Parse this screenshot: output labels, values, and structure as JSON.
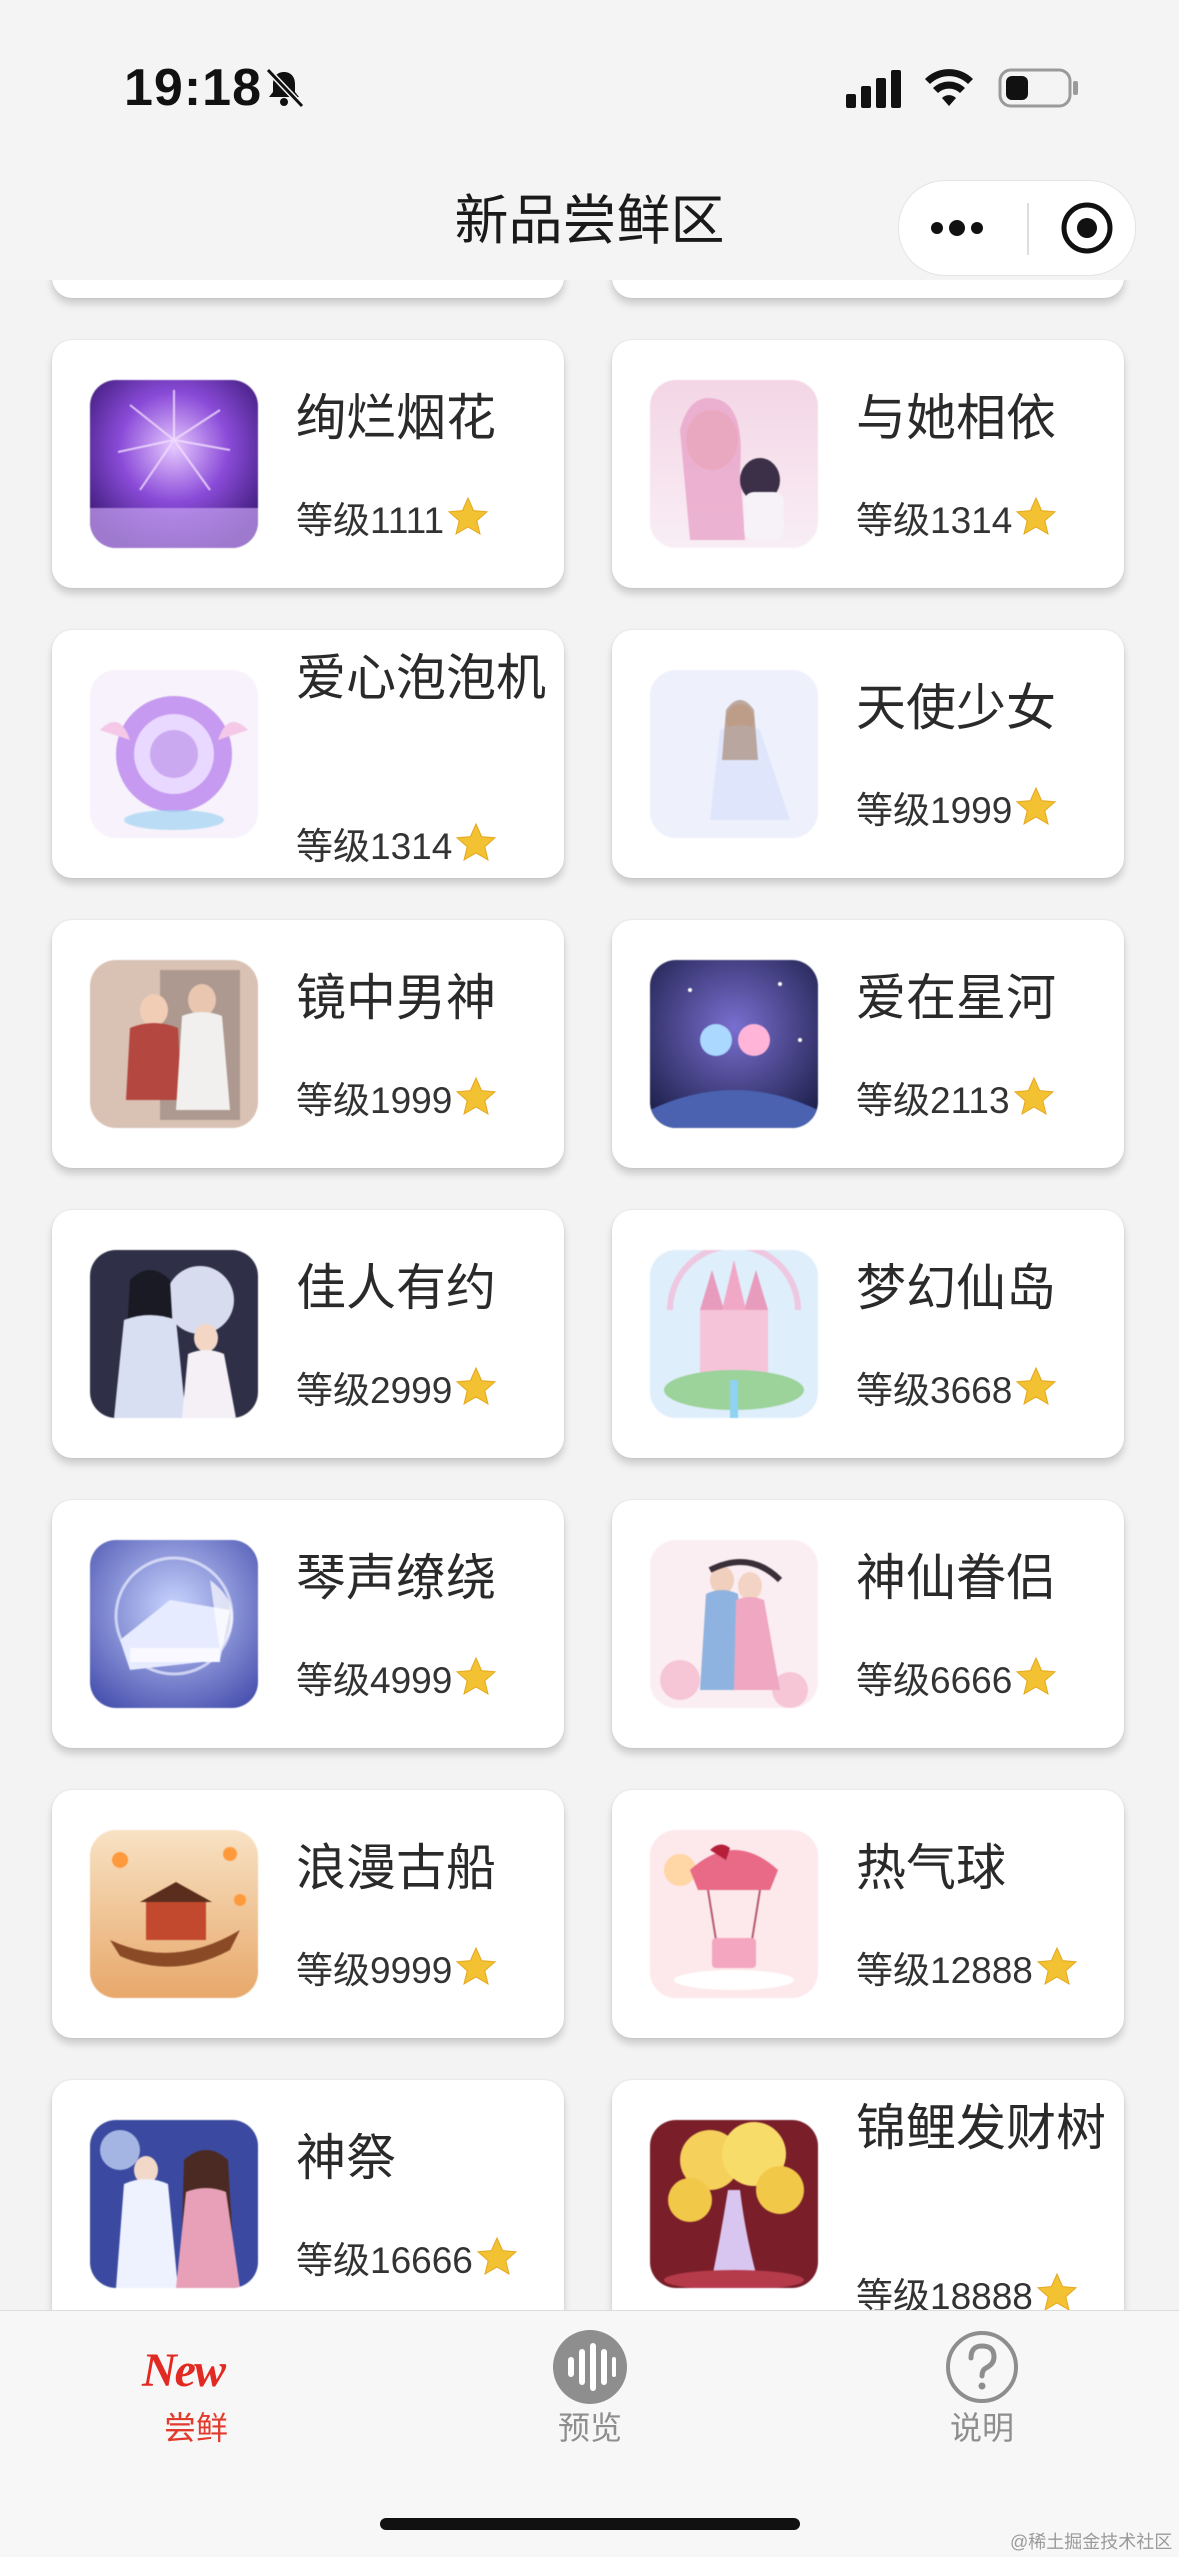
{
  "status_bar": {
    "time": "19:18"
  },
  "nav": {
    "title": "新品尝鲜区"
  },
  "items": [
    {
      "title": "绚烂烟花",
      "level": "等级1111",
      "thumb": "fireworks"
    },
    {
      "title": "与她相依",
      "level": "等级1314",
      "thumb": "couple"
    },
    {
      "title": "爱心泡泡机",
      "level": "等级1314",
      "thumb": "bubble-machine"
    },
    {
      "title": "天使少女",
      "level": "等级1999",
      "thumb": "angel-girl"
    },
    {
      "title": "镜中男神",
      "level": "等级1999",
      "thumb": "mirror-god"
    },
    {
      "title": "爱在星河",
      "level": "等级2113",
      "thumb": "galaxy-love"
    },
    {
      "title": "佳人有约",
      "level": "等级2999",
      "thumb": "moon-date"
    },
    {
      "title": "梦幻仙岛",
      "level": "等级3668",
      "thumb": "castle"
    },
    {
      "title": "琴声缭绕",
      "level": "等级4999",
      "thumb": "piano"
    },
    {
      "title": "神仙眷侣",
      "level": "等级6666",
      "thumb": "immortal-couple"
    },
    {
      "title": "浪漫古船",
      "level": "等级9999",
      "thumb": "boat"
    },
    {
      "title": "热气球",
      "level": "等级12888",
      "thumb": "balloon"
    },
    {
      "title": "神祭",
      "level": "等级16666",
      "thumb": "festival"
    },
    {
      "title": "锦鲤发财树",
      "level": "等级18888",
      "thumb": "golden-tree"
    }
  ],
  "tabs": [
    {
      "label": "尝鲜",
      "icon": "new-icon",
      "active": true
    },
    {
      "label": "预览",
      "icon": "waveform-icon",
      "active": false
    },
    {
      "label": "说明",
      "icon": "question-icon",
      "active": false
    }
  ],
  "tab_logo": "New",
  "watermark": "@稀土掘金技术社区",
  "colors": {
    "active_tab": "#e23b2d",
    "inactive_tab": "#8e8e8e",
    "star": "#f2c232"
  }
}
